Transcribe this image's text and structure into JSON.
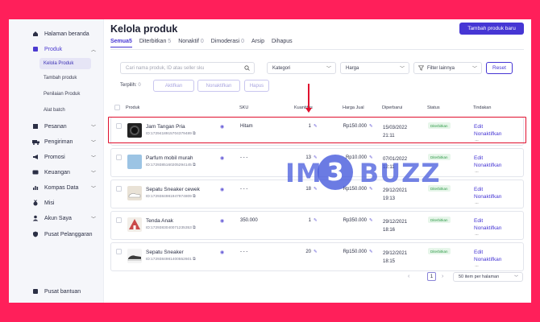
{
  "sidebar": {
    "items": [
      {
        "label": "Halaman beranda",
        "icon": "home-icon"
      },
      {
        "label": "Produk",
        "icon": "box-icon"
      },
      {
        "label": "Pesanan",
        "icon": "list-icon"
      },
      {
        "label": "Pengiriman",
        "icon": "truck-icon"
      },
      {
        "label": "Promosi",
        "icon": "megaphone-icon"
      },
      {
        "label": "Keuangan",
        "icon": "wallet-icon"
      },
      {
        "label": "Kompas Data",
        "icon": "chart-icon"
      },
      {
        "label": "Misi",
        "icon": "medal-icon"
      },
      {
        "label": "Akun Saya",
        "icon": "user-icon"
      },
      {
        "label": "Pusat Pelanggaran",
        "icon": "shield-icon"
      },
      {
        "label": "Pusat bantuan",
        "icon": "help-icon"
      }
    ],
    "sub": [
      "Kelola Produk",
      "Tambah produk",
      "Penilaian Produk",
      "Alat batch"
    ]
  },
  "header": {
    "title": "Kelola produk",
    "add_button": "Tambah produk baru"
  },
  "tabs": [
    {
      "label": "Semua",
      "count": "5"
    },
    {
      "label": "Diterbitkan",
      "count": "5"
    },
    {
      "label": "Nonaktif",
      "count": "0"
    },
    {
      "label": "Dimoderasi",
      "count": "0"
    },
    {
      "label": "Arsip",
      "count": ""
    },
    {
      "label": "Dihapus",
      "count": ""
    }
  ],
  "filters": {
    "search_placeholder": "Cari nama produk, ID atau seller sku",
    "category": "Kategori",
    "price": "Harga",
    "more": "Filter lainnya",
    "reset": "Reset"
  },
  "selection": {
    "label": "Terpilih:",
    "count": "0",
    "activate": "Aktifkan",
    "deactivate": "Nonaktifkan",
    "delete": "Hapus"
  },
  "table": {
    "columns": [
      "Produk",
      "SKU",
      "Kuantitas",
      "Harga Jual",
      "Diperbarui",
      "Status",
      "Tindakan"
    ],
    "rows": [
      {
        "name": "Jam Tangan Pria",
        "id": "ID:1729418915704379489",
        "sku": "Hitam",
        "qty": "1",
        "price": "Rp150.000",
        "date": "15/03/2022",
        "time": "21:11",
        "status": "Diterbitkan",
        "edit": "Edit",
        "deactivate": "Nonaktifkan",
        "more": "···",
        "thumb_color": "#222222"
      },
      {
        "name": "Parfum mobil murah",
        "id": "ID:1729385160205294145",
        "sku": "- - -",
        "qty": "13",
        "price": "Rp10.000",
        "date": "07/01/2022",
        "time": "12:11",
        "status": "Diterbitkan",
        "edit": "Edit",
        "deactivate": "Nonaktifkan",
        "more": "···",
        "thumb_color": "#9cc4e4"
      },
      {
        "name": "Sepatu Sneaker cewek",
        "id": "ID:1729384981947974809",
        "sku": "- - -",
        "qty": "18",
        "price": "Rp150.000",
        "date": "29/12/2021",
        "time": "19:13",
        "status": "Diterbitkan",
        "edit": "Edit",
        "deactivate": "Nonaktifkan",
        "more": "···",
        "thumb_color": "#e9e2d6"
      },
      {
        "name": "Tenda Anak",
        "id": "ID:1729383040071235353",
        "sku": "350.000",
        "qty": "1",
        "price": "Rp350.000",
        "date": "29/12/2021",
        "time": "18:16",
        "status": "Diterbitkan",
        "edit": "Edit",
        "deactivate": "Nonaktifkan",
        "more": "···",
        "thumb_color": "#c94a4a"
      },
      {
        "name": "Sepatu Sneaker",
        "id": "ID:1729384981400552601",
        "sku": "- - -",
        "qty": "20",
        "price": "Rp150.000",
        "date": "29/12/2021",
        "time": "18:15",
        "status": "Diterbitkan",
        "edit": "Edit",
        "deactivate": "Nonaktifkan",
        "more": "···",
        "thumb_color": "#3a3a3a"
      }
    ]
  },
  "pagination": {
    "page": "1",
    "per_page": "50 item per halaman"
  },
  "watermark": {
    "left": "IM",
    "mid": "3",
    "right": "BUZZ"
  },
  "colors": {
    "accent": "#4636d4",
    "frame": "#ff1f5a",
    "highlight": "#e0102e",
    "status": "#2f9a48"
  }
}
